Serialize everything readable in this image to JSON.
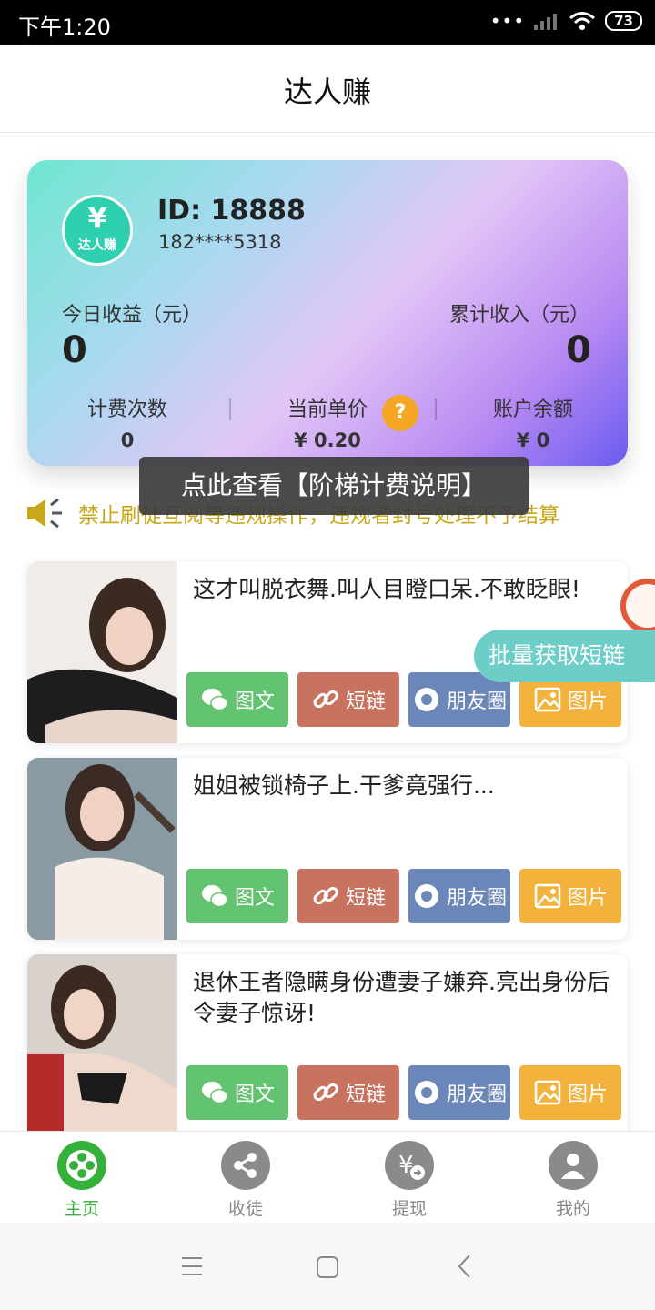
{
  "status": {
    "time": "下午1:20",
    "battery": "73"
  },
  "header": {
    "title": "达人赚"
  },
  "account": {
    "logo_text": "达人赚",
    "id": "ID: 18888",
    "phone": "182****5318",
    "today_label": "今日收益（元）",
    "today_value": "0",
    "total_label": "累计收入（元）",
    "total_value": "0",
    "stats": [
      {
        "label": "计费次数",
        "value": "0"
      },
      {
        "label": "当前单价",
        "value": "¥ 0.20"
      },
      {
        "label": "账户余额",
        "value": "¥ 0"
      }
    ]
  },
  "tooltip": "点此查看【阶梯计费说明】",
  "notice": "禁止刷徒互阅等违规操作，违规者封号处理不予结算",
  "float_button": "批量获取短链",
  "buttons": {
    "wechat": "图文",
    "link": "短链",
    "moments": "朋友圈",
    "image": "图片"
  },
  "articles": [
    {
      "title": "这才叫脱衣舞.叫人目瞪口呆.不敢眨眼!"
    },
    {
      "title": "姐姐被锁椅子上.干爹竟强行..."
    },
    {
      "title": "退休王者隐瞒身份遭妻子嫌弃.亮出身份后令妻子惊讶!"
    }
  ],
  "tabs": [
    {
      "label": "主页",
      "icon": "film-reel-icon",
      "active": true
    },
    {
      "label": "收徒",
      "icon": "share-icon",
      "active": false
    },
    {
      "label": "提现",
      "icon": "withdraw-yen-icon",
      "active": false
    },
    {
      "label": "我的",
      "icon": "user-icon",
      "active": false
    }
  ],
  "colors": {
    "accent_green": "#35b03a",
    "wechat": "#62c370",
    "link": "#c8735f",
    "moments": "#6b86b8",
    "image": "#f2b23c",
    "help": "#f5a623",
    "notice": "#c8a81a"
  }
}
